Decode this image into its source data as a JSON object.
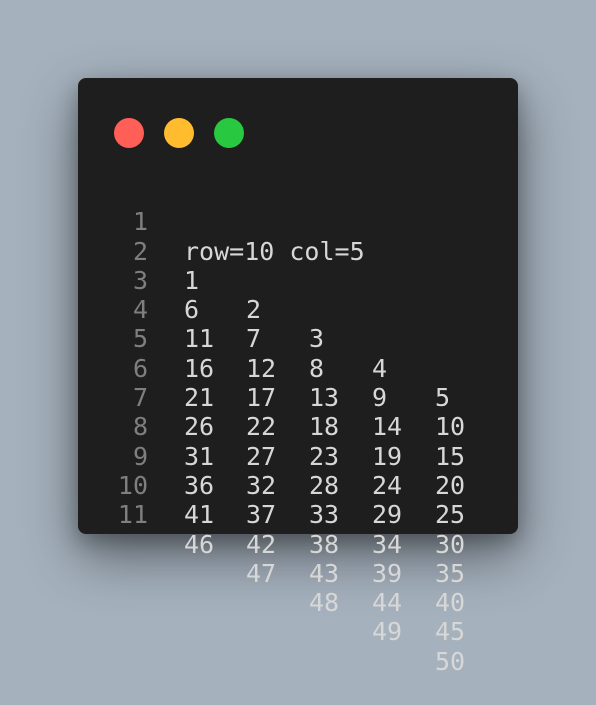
{
  "window": {
    "controls": {
      "close_color": "#ff5f57",
      "minimize_color": "#febc2e",
      "maximize_color": "#28c840"
    }
  },
  "editor": {
    "line_numbers": [
      "1",
      "2",
      "3",
      "4",
      "5",
      "6",
      "7",
      "8",
      "9",
      "10",
      "11"
    ],
    "header_line": "row=10 col=5",
    "table_rows": [
      [
        "1",
        "2",
        "3",
        "4",
        "5"
      ],
      [
        "6",
        "7",
        "8",
        "9",
        "10"
      ],
      [
        "11",
        "12",
        "13",
        "14",
        "15"
      ],
      [
        "16",
        "17",
        "18",
        "19",
        "20"
      ],
      [
        "21",
        "22",
        "23",
        "24",
        "25"
      ],
      [
        "26",
        "27",
        "28",
        "29",
        "30"
      ],
      [
        "31",
        "32",
        "33",
        "34",
        "35"
      ],
      [
        "36",
        "37",
        "38",
        "39",
        "40"
      ],
      [
        "41",
        "42",
        "43",
        "44",
        "45"
      ],
      [
        "46",
        "47",
        "48",
        "49",
        "50"
      ]
    ]
  }
}
